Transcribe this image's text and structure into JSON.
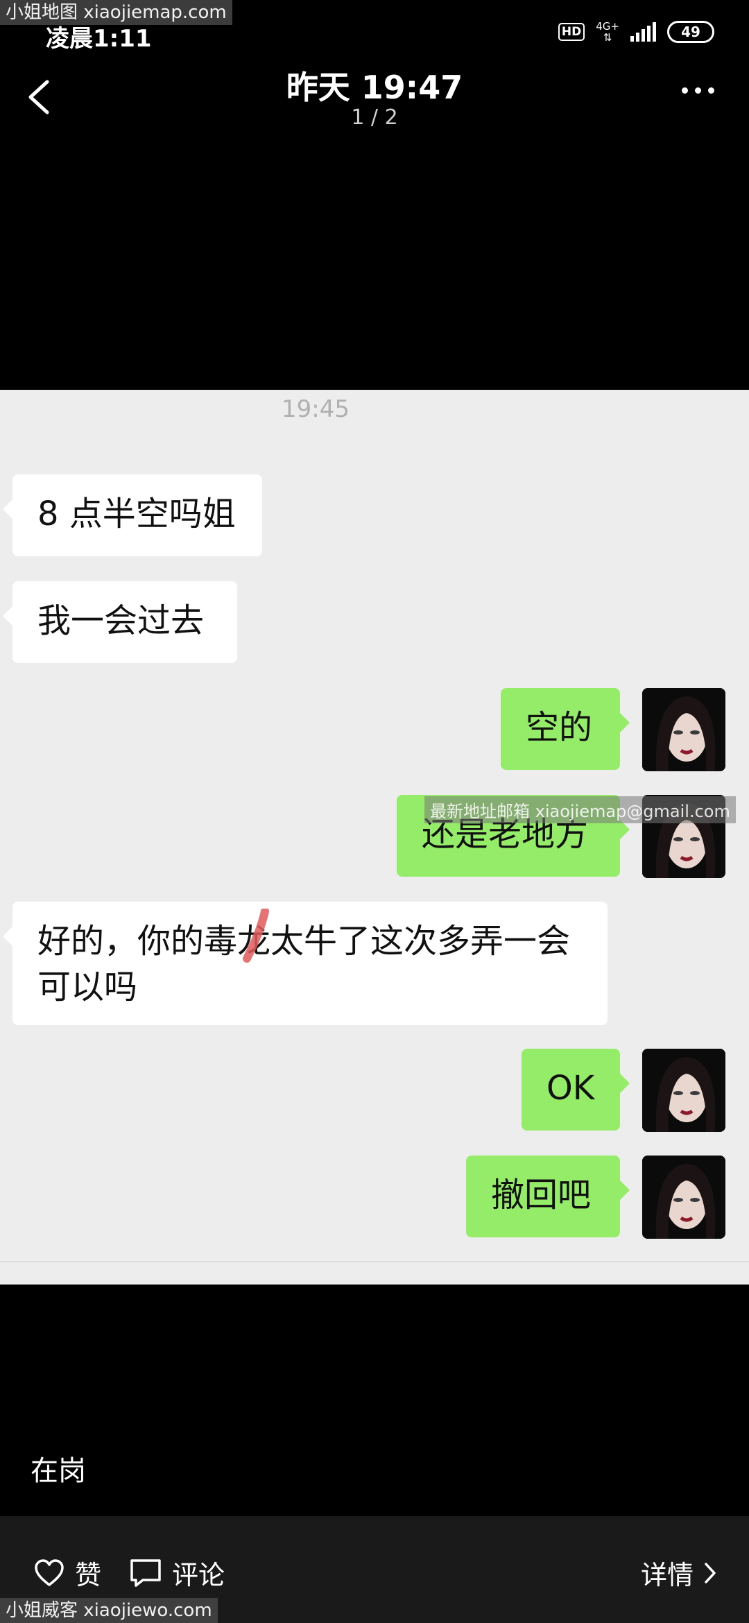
{
  "watermarks": {
    "top_left": "小姐地图 xiaojiemap.com",
    "bottom_left": "小姐威客 xiaojiewo.com",
    "middle": "最新地址邮箱 xiaojiemap@gmail.com"
  },
  "status_bar": {
    "time": "凌晨1:11",
    "hd": "HD",
    "network": "4G+",
    "network_arrows": "⇅",
    "battery": "49"
  },
  "header": {
    "title": "昨天 19:47",
    "page_indicator": "1 / 2"
  },
  "chat": {
    "timestamp": "19:45",
    "messages": [
      {
        "side": "in",
        "text": "8 点半空吗姐"
      },
      {
        "side": "in",
        "text": "我一会过去"
      },
      {
        "side": "out",
        "text": "空的"
      },
      {
        "side": "out",
        "text": "还是老地方"
      },
      {
        "side": "in",
        "text": "好的，你的毒龙太牛了这次多弄一会可以吗"
      },
      {
        "side": "out",
        "text": "OK"
      },
      {
        "side": "out",
        "text": "撤回吧"
      }
    ]
  },
  "caption": "在岗",
  "actions": {
    "like": "赞",
    "comment": "评论",
    "details": "详情"
  }
}
